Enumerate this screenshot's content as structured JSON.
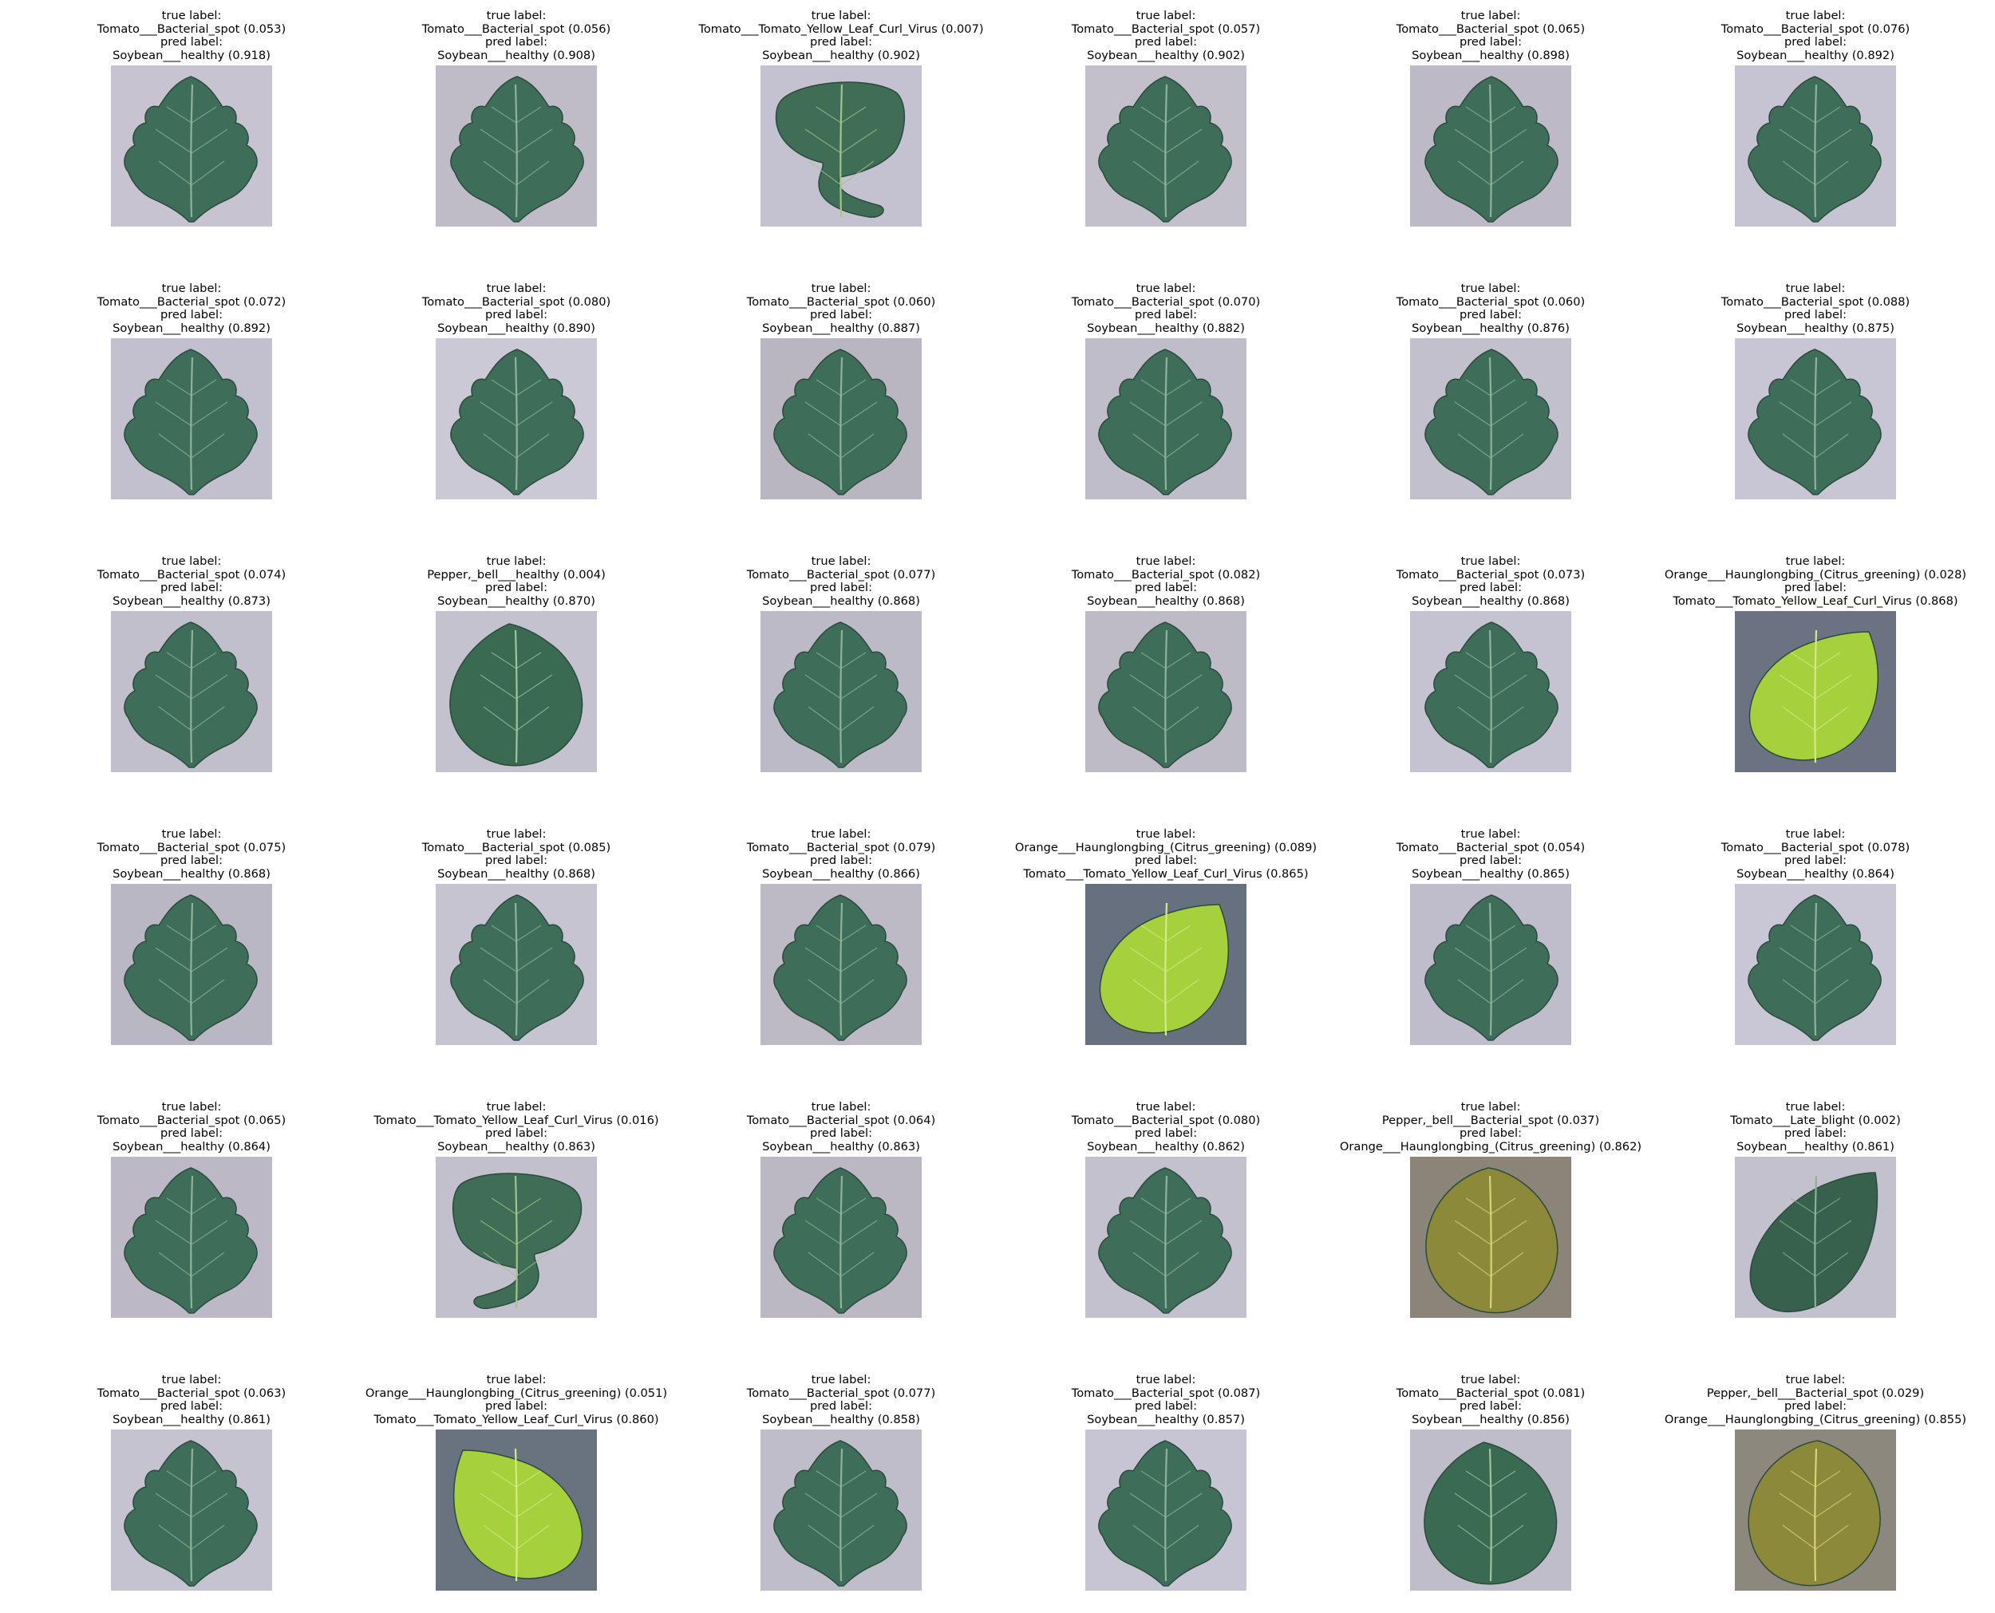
{
  "header_true": "true label:",
  "header_pred": "pred label:",
  "samples": [
    {
      "true_text": "Tomato___Bacterial_spot (0.053)",
      "pred_text": "Soybean___healthy (0.918)",
      "leaf": "tomato",
      "bg": "#c7c3d0"
    },
    {
      "true_text": "Tomato___Bacterial_spot (0.056)",
      "pred_text": "Soybean___healthy (0.908)",
      "leaf": "tomato",
      "bg": "#bfbcc7"
    },
    {
      "true_text": "Tomato___Tomato_Yellow_Leaf_Curl_Virus (0.007)",
      "pred_text": "Soybean___healthy (0.902)",
      "leaf": "curl",
      "bg": "#c4c2d0"
    },
    {
      "true_text": "Tomato___Bacterial_spot (0.057)",
      "pred_text": "Soybean___healthy (0.902)",
      "leaf": "tomato",
      "bg": "#c3bfcb"
    },
    {
      "true_text": "Tomato___Bacterial_spot (0.065)",
      "pred_text": "Soybean___healthy (0.898)",
      "leaf": "tomato",
      "bg": "#bdb9c6"
    },
    {
      "true_text": "Tomato___Bacterial_spot (0.076)",
      "pred_text": "Soybean___healthy (0.892)",
      "leaf": "tomato",
      "bg": "#c6c4d2"
    },
    {
      "true_text": "Tomato___Bacterial_spot (0.072)",
      "pred_text": "Soybean___healthy (0.892)",
      "leaf": "tomato",
      "bg": "#c2c0ce"
    },
    {
      "true_text": "Tomato___Bacterial_spot (0.080)",
      "pred_text": "Soybean___healthy (0.890)",
      "leaf": "tomato",
      "bg": "#cbc9d6"
    },
    {
      "true_text": "Tomato___Bacterial_spot (0.060)",
      "pred_text": "Soybean___healthy (0.887)",
      "leaf": "tomato",
      "bg": "#b9b6c2"
    },
    {
      "true_text": "Tomato___Bacterial_spot (0.070)",
      "pred_text": "Soybean___healthy (0.882)",
      "leaf": "tomato",
      "bg": "#c0bdca"
    },
    {
      "true_text": "Tomato___Bacterial_spot (0.060)",
      "pred_text": "Soybean___healthy (0.876)",
      "leaf": "tomato",
      "bg": "#c3c0cd"
    },
    {
      "true_text": "Tomato___Bacterial_spot (0.088)",
      "pred_text": "Soybean___healthy (0.875)",
      "leaf": "tomato",
      "bg": "#c8c6d4"
    },
    {
      "true_text": "Tomato___Bacterial_spot (0.074)",
      "pred_text": "Soybean___healthy (0.873)",
      "leaf": "tomato",
      "bg": "#c1bfcc"
    },
    {
      "true_text": "Pepper,_bell___healthy (0.004)",
      "pred_text": "Soybean___healthy (0.870)",
      "leaf": "pepper",
      "bg": "#c4c2ce"
    },
    {
      "true_text": "Tomato___Bacterial_spot (0.077)",
      "pred_text": "Soybean___healthy (0.868)",
      "leaf": "tomato",
      "bg": "#bcbac6"
    },
    {
      "true_text": "Tomato___Bacterial_spot (0.082)",
      "pred_text": "Soybean___healthy (0.868)",
      "leaf": "tomato",
      "bg": "#bebbc7"
    },
    {
      "true_text": "Tomato___Bacterial_spot (0.073)",
      "pred_text": "Soybean___healthy (0.868)",
      "leaf": "tomato",
      "bg": "#c5c3d1"
    },
    {
      "true_text": "Orange___Haunglongbing_(Citrus_greening) (0.028)",
      "pred_text": "Tomato___Tomato_Yellow_Leaf_Curl_Virus (0.868)",
      "leaf": "citrus",
      "bg": "#6b7382"
    },
    {
      "true_text": "Tomato___Bacterial_spot (0.075)",
      "pred_text": "Soybean___healthy (0.868)",
      "leaf": "tomato",
      "bg": "#bab7c4"
    },
    {
      "true_text": "Tomato___Bacterial_spot (0.085)",
      "pred_text": "Soybean___healthy (0.868)",
      "leaf": "tomato",
      "bg": "#c6c4d0"
    },
    {
      "true_text": "Tomato___Bacterial_spot (0.079)",
      "pred_text": "Soybean___healthy (0.866)",
      "leaf": "tomato",
      "bg": "#bdbac6"
    },
    {
      "true_text": "Orange___Haunglongbing_(Citrus_greening) (0.089)",
      "pred_text": "Tomato___Tomato_Yellow_Leaf_Curl_Virus (0.865)",
      "leaf": "citrus",
      "bg": "#66707e"
    },
    {
      "true_text": "Tomato___Bacterial_spot (0.054)",
      "pred_text": "Soybean___healthy (0.865)",
      "leaf": "tomato",
      "bg": "#bfbccb"
    },
    {
      "true_text": "Tomato___Bacterial_spot (0.078)",
      "pred_text": "Soybean___healthy (0.864)",
      "leaf": "tomato",
      "bg": "#c9c7d5"
    },
    {
      "true_text": "Tomato___Bacterial_spot (0.065)",
      "pred_text": "Soybean___healthy (0.864)",
      "leaf": "tomato",
      "bg": "#bcb8c5"
    },
    {
      "true_text": "Tomato___Tomato_Yellow_Leaf_Curl_Virus (0.016)",
      "pred_text": "Soybean___healthy (0.863)",
      "leaf": "curl",
      "bg": "#c2c0cd"
    },
    {
      "true_text": "Tomato___Bacterial_spot (0.064)",
      "pred_text": "Soybean___healthy (0.863)",
      "leaf": "tomato",
      "bg": "#bbb8c4"
    },
    {
      "true_text": "Tomato___Bacterial_spot (0.080)",
      "pred_text": "Soybean___healthy (0.862)",
      "leaf": "tomato",
      "bg": "#c4c1ce"
    },
    {
      "true_text": "Pepper,_bell___Bacterial_spot (0.037)",
      "pred_text": "Orange___Haunglongbing_(Citrus_greening) (0.862)",
      "leaf": "pepperspot",
      "bg": "#8a8578"
    },
    {
      "true_text": "Tomato___Late_blight (0.002)",
      "pred_text": "Soybean___healthy (0.861)",
      "leaf": "blight",
      "bg": "#c3c1cd"
    },
    {
      "true_text": "Tomato___Bacterial_spot (0.063)",
      "pred_text": "Soybean___healthy (0.861)",
      "leaf": "tomato",
      "bg": "#c6c3d1"
    },
    {
      "true_text": "Orange___Haunglongbing_(Citrus_greening) (0.051)",
      "pred_text": "Tomato___Tomato_Yellow_Leaf_Curl_Virus (0.860)",
      "leaf": "citrus",
      "bg": "#69727f"
    },
    {
      "true_text": "Tomato___Bacterial_spot (0.077)",
      "pred_text": "Soybean___healthy (0.858)",
      "leaf": "tomato",
      "bg": "#bfbdc9"
    },
    {
      "true_text": "Tomato___Bacterial_spot (0.087)",
      "pred_text": "Soybean___healthy (0.857)",
      "leaf": "tomato",
      "bg": "#c7c5d3"
    },
    {
      "true_text": "Tomato___Bacterial_spot (0.081)",
      "pred_text": "Soybean___healthy (0.856)",
      "leaf": "pepper",
      "bg": "#c0bdca"
    },
    {
      "true_text": "Pepper,_bell___Bacterial_spot (0.029)",
      "pred_text": "Orange___Haunglongbing_(Citrus_greening) (0.855)",
      "leaf": "pepperspot",
      "bg": "#8d887d"
    }
  ]
}
